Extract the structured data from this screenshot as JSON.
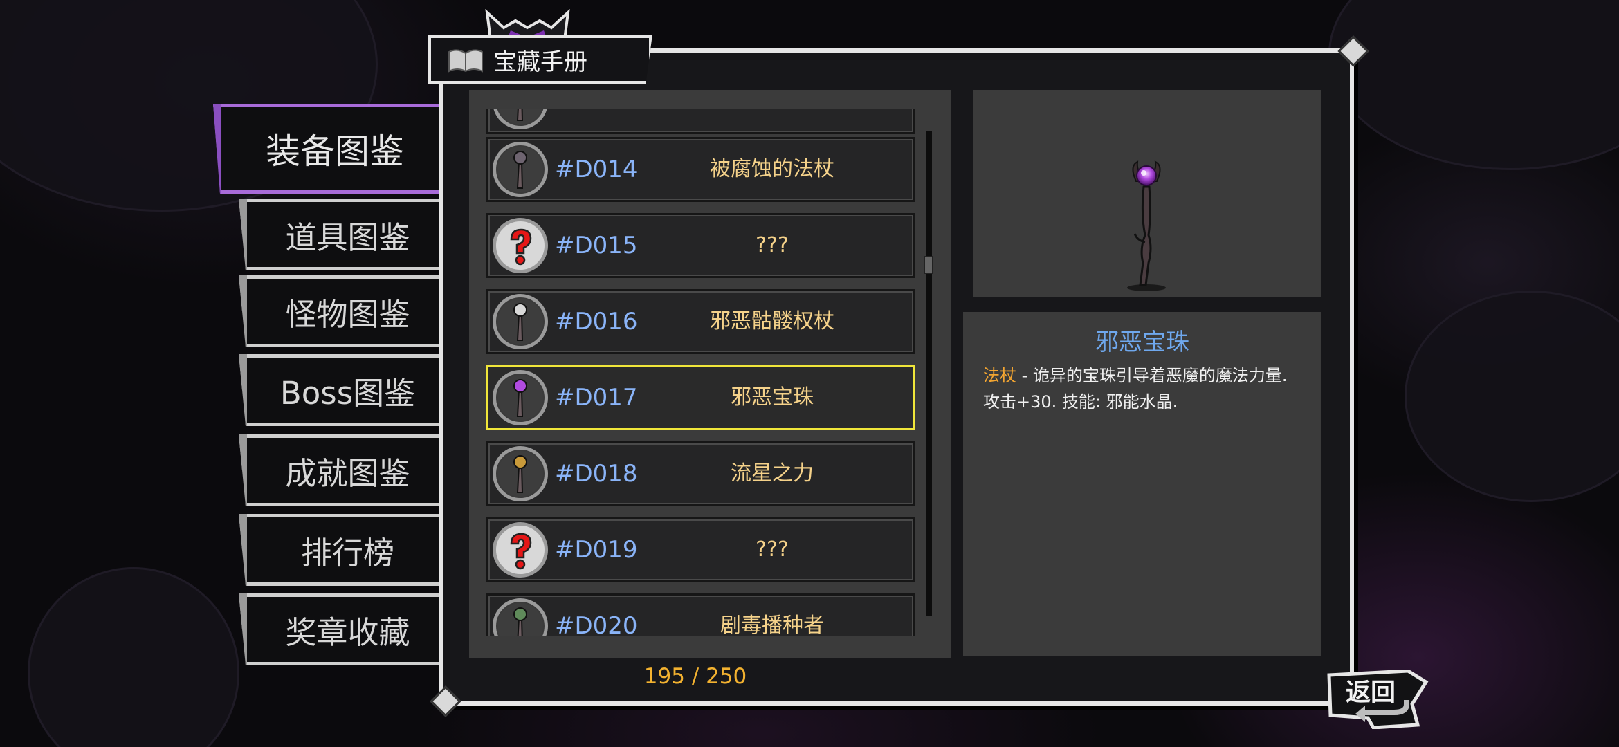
{
  "header": {
    "title": "宝藏手册"
  },
  "tabs": [
    {
      "label": "装备图鉴",
      "active": true
    },
    {
      "label": "道具图鉴",
      "active": false
    },
    {
      "label": "怪物图鉴",
      "active": false
    },
    {
      "label": "Boss图鉴",
      "active": false
    },
    {
      "label": "成就图鉴",
      "active": false
    },
    {
      "label": "排行榜",
      "active": false
    },
    {
      "label": "奖章收藏",
      "active": false
    }
  ],
  "list": {
    "entries": [
      {
        "code": "",
        "name": "",
        "icon": "staff-icon"
      },
      {
        "code": "#D014",
        "name": "被腐蚀的法杖",
        "icon": "corroded-staff-icon"
      },
      {
        "code": "#D015",
        "name": "???",
        "icon": "question-mark-icon"
      },
      {
        "code": "#D016",
        "name": "邪恶骷髅权杖",
        "icon": "skull-scepter-icon"
      },
      {
        "code": "#D017",
        "name": "邪恶宝珠",
        "icon": "evil-orb-staff-icon",
        "selected": true
      },
      {
        "code": "#D018",
        "name": "流星之力",
        "icon": "meteor-staff-icon"
      },
      {
        "code": "#D019",
        "name": "???",
        "icon": "question-mark-icon"
      },
      {
        "code": "#D020",
        "name": "剧毒播种者",
        "icon": "poison-seeder-icon"
      }
    ],
    "progress_text": "195 / 250",
    "collected": 195,
    "total": 250
  },
  "detail": {
    "title": "邪恶宝珠",
    "type": "法杖",
    "separator": " - ",
    "description_line1": "诡异的宝珠引导着恶魔的魔法力量.",
    "description_line2": "攻击+30. 技能: 邪能水晶."
  },
  "back_button": {
    "label": "返回"
  },
  "colors": {
    "accent_purple": "#a86bd9",
    "selected_border": "#f0e63a",
    "code_blue": "#8ab4f8",
    "name_gold": "#f5d28a",
    "count_orange": "#f3b230",
    "title_blue": "#6fa8ee"
  }
}
